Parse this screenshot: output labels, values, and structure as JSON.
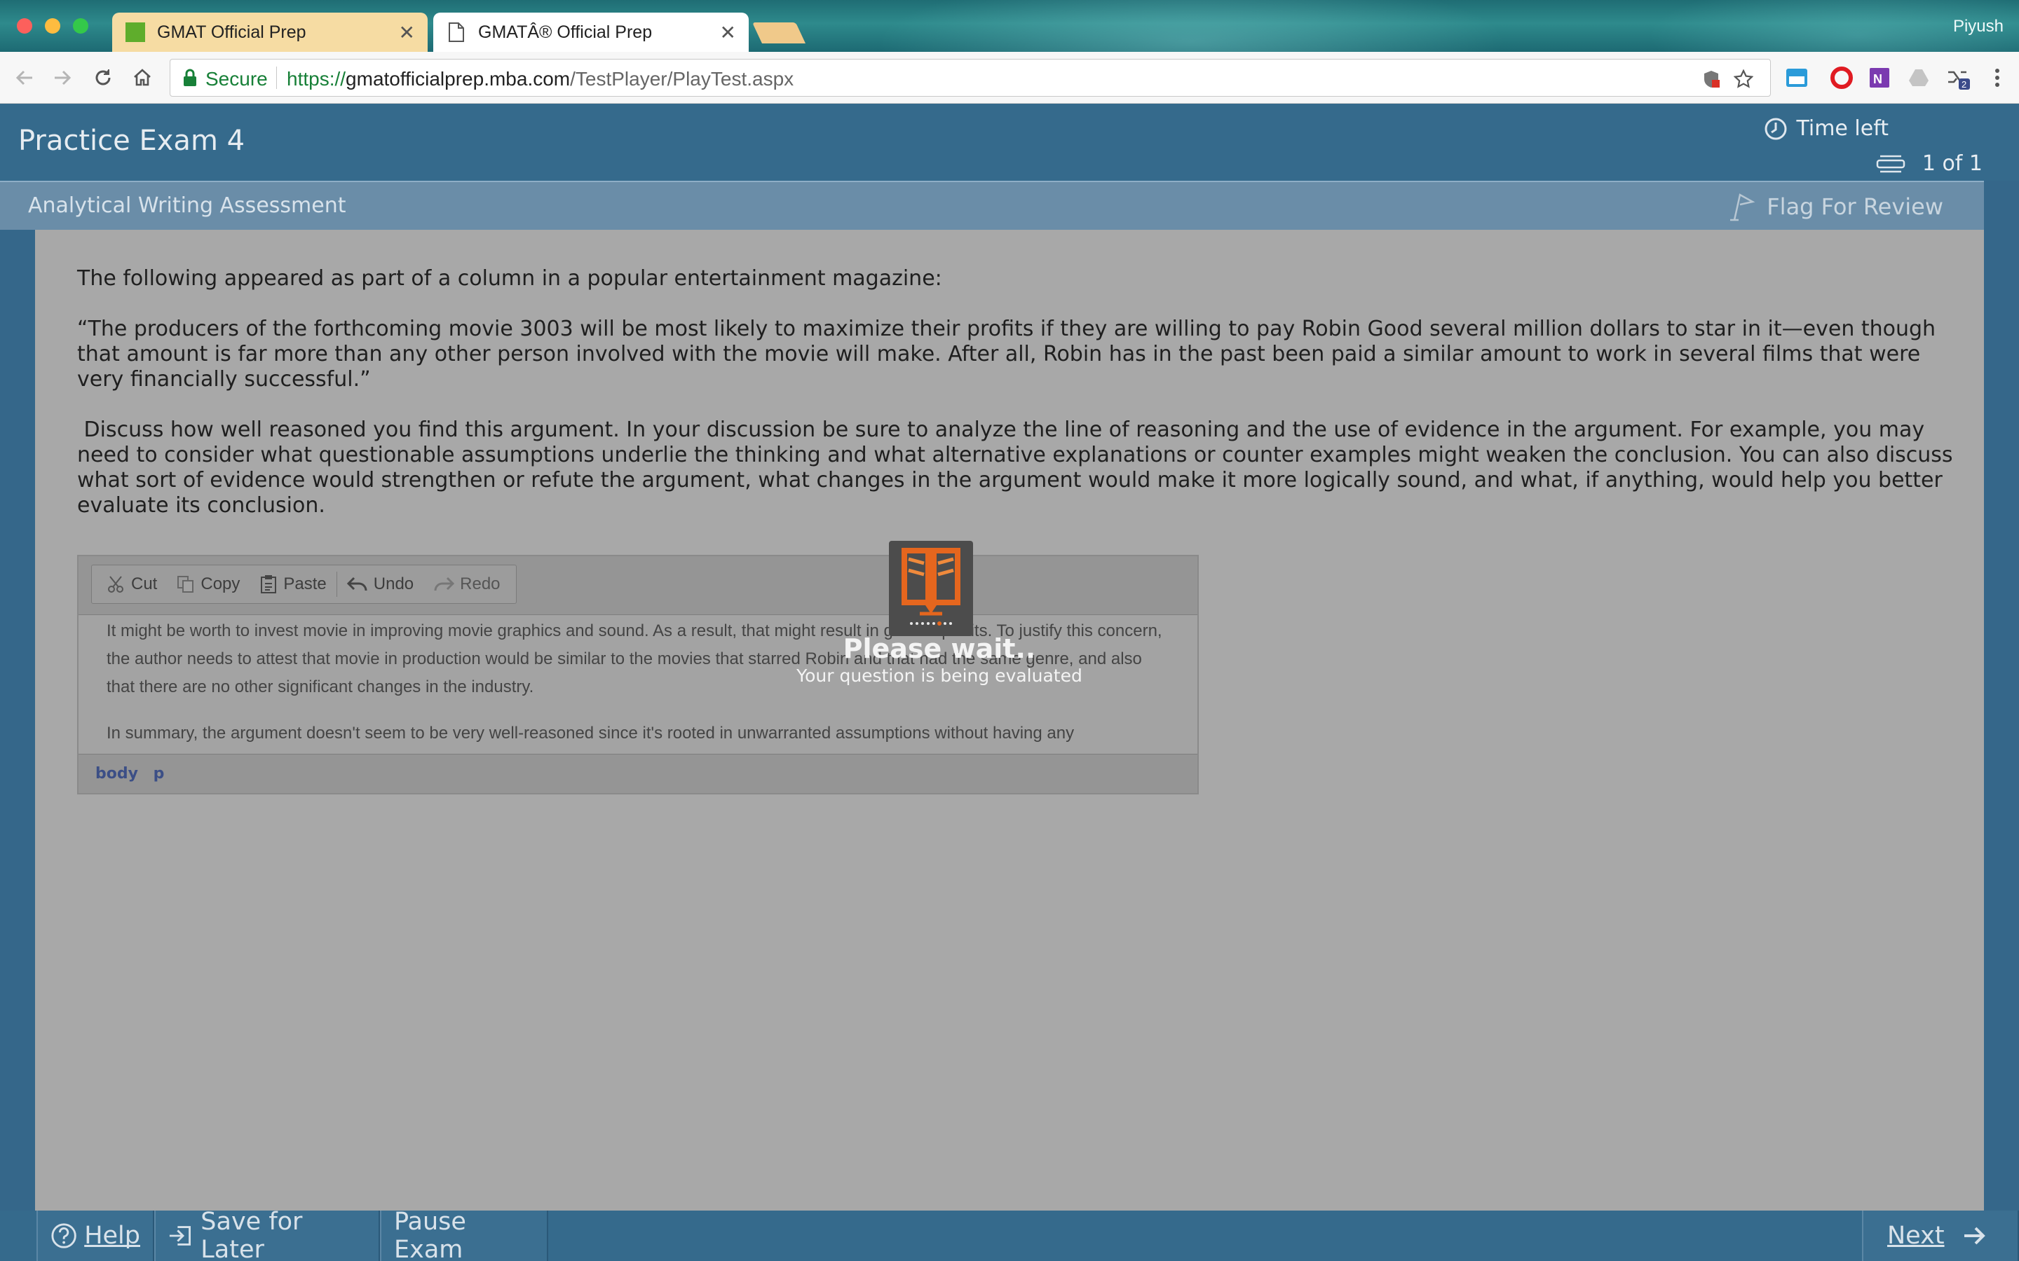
{
  "browser": {
    "tabs": [
      {
        "title": "GMAT Official Prep",
        "active": false
      },
      {
        "title": "GMATÂ® Official Prep",
        "active": true
      }
    ],
    "profile": "Piyush",
    "secure_label": "Secure",
    "url": {
      "scheme": "https://",
      "host": "gmatofficialprep.mba.com",
      "path": "/TestPlayer/PlayTest.aspx"
    }
  },
  "exam": {
    "title": "Practice Exam 4",
    "time_left_label": "Time left",
    "page_count": "1 of 1",
    "section_title": "Analytical Writing Assessment",
    "flag_label": "Flag For Review"
  },
  "prompt": {
    "intro": "The following appeared as part of a column in a popular entertainment magazine:",
    "argument": "“The producers of the forthcoming movie 3003 will be most likely to maximize their profits if they are willing to pay Robin Good several million dollars to star in it—even though that amount is far more than any other person involved with the movie will make. After all, Robin has in the past been paid a similar amount to work in several films that were very financially successful.”",
    "instructions": " Discuss how well reasoned you find this argument. In your discussion be sure to analyze the line of reasoning and the use of evidence in the argument. For example, you may need to consider what questionable assumptions underlie the thinking and what alternative explanations or counter examples might weaken the conclusion. You can also discuss what sort of evidence would strengthen or refute the argument, what changes in the argument would make it more logically sound, and what, if anything, would help you better evaluate its conclusion."
  },
  "editor": {
    "buttons": {
      "cut": "Cut",
      "copy": "Copy",
      "paste": "Paste",
      "undo": "Undo",
      "redo": "Redo"
    },
    "paragraph1": "It might be worth to invest movie in improving movie graphics and sound. As a result, that might result in greater profits. To justify this concern, the author needs to attest that movie in production would be similar to the movies that starred Robin and that had the same genre, and also that there are no other significant changes in the industry.",
    "paragraph2": "In summary, the argument doesn't seem to be very well-reasoned since it's rooted in unwarranted assumptions without having any",
    "status_path": [
      "body",
      "p"
    ]
  },
  "overlay": {
    "title": "Please wait..",
    "subtitle": "Your question is being evaluated"
  },
  "footer": {
    "help": "Help",
    "save": "Save for Later",
    "pause": "Pause Exam",
    "next": "Next"
  },
  "colors": {
    "header_blue": "#356a8c",
    "section_blue": "#6a8da8",
    "secure_green": "#188038",
    "icon_orange": "#e5661e"
  }
}
